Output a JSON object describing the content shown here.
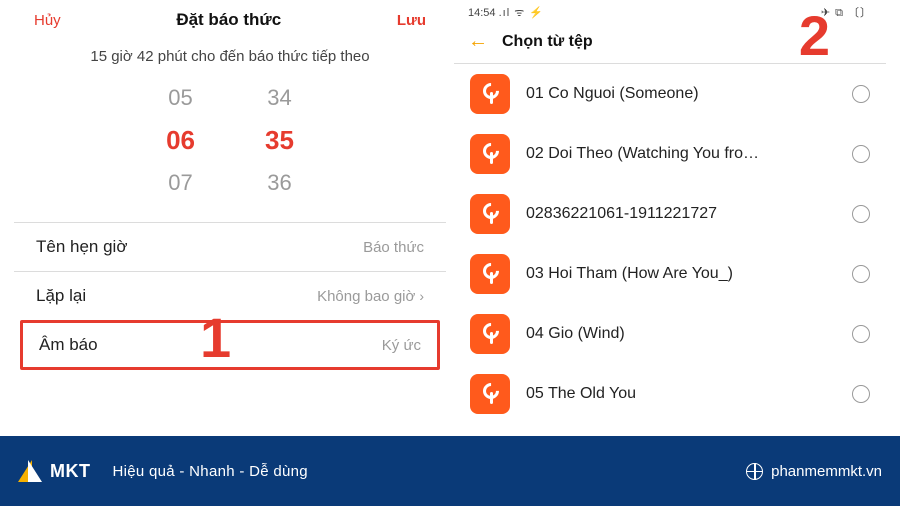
{
  "brand": {
    "name": "MKT"
  },
  "left": {
    "cancel": "Hủy",
    "title": "Đặt báo thức",
    "save": "Lưu",
    "countdown": "15 giờ 42 phút cho đến báo thức tiếp theo",
    "picker": {
      "h_prev": "05",
      "h_sel": "06",
      "h_next": "07",
      "m_prev": "34",
      "m_sel": "35",
      "m_next": "36"
    },
    "rows": {
      "name_label": "Tên hẹn giờ",
      "name_value": "Báo thức",
      "repeat_label": "Lặp lại",
      "repeat_value": "Không bao giờ",
      "sound_label": "Âm báo",
      "sound_value": "Ký ức"
    }
  },
  "right": {
    "status_time": "14:54",
    "status_left_icons": ".ıl ᯤ ⚡",
    "status_right_icons": "✈ ⧉ 〔〕",
    "title": "Chọn từ tệp",
    "files": [
      "01 Co Nguoi (Someone)",
      "02 Doi Theo (Watching You fro…",
      "02836221061-1911221727",
      "03 Hoi Tham (How Are You_)",
      "04 Gio (Wind)",
      "05 The Old You"
    ]
  },
  "steps": {
    "one": "1",
    "two": "2"
  },
  "footer": {
    "tagline": "Hiệu quả - Nhanh  - Dễ dùng",
    "site": "phanmemmkt.vn"
  }
}
